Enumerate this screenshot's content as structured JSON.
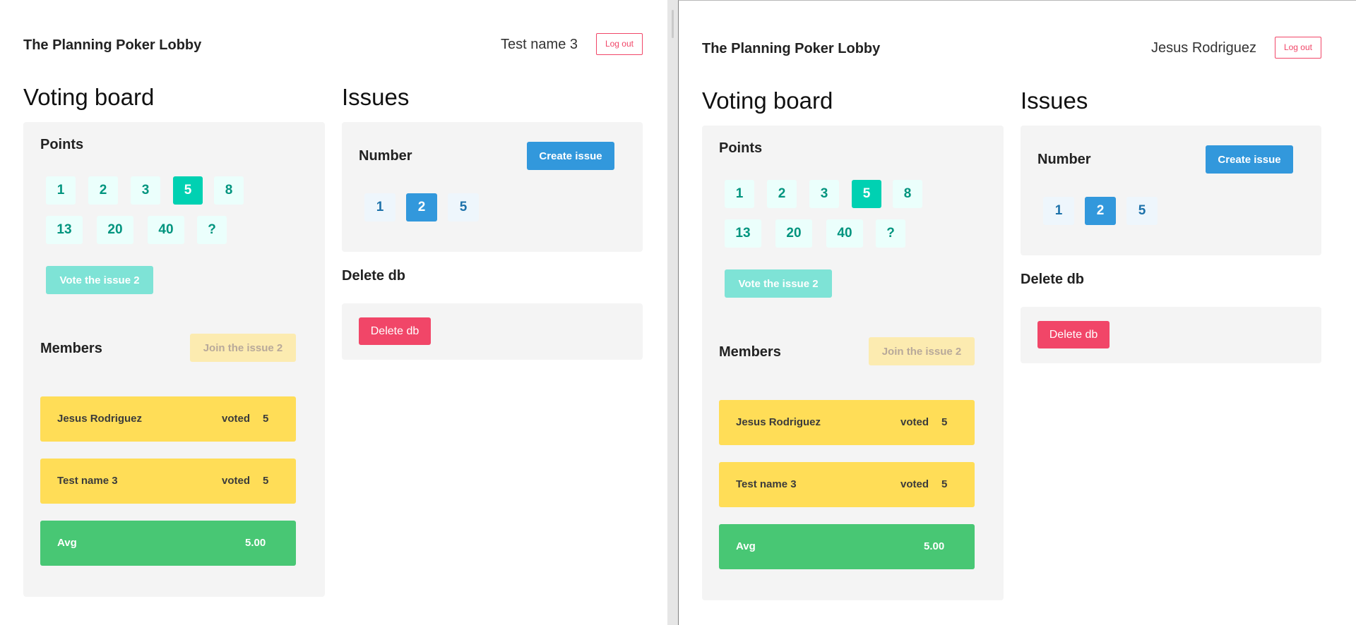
{
  "windows": [
    {
      "brand": "The Planning Poker Lobby",
      "username": "Test name 3",
      "logout_label": "Log out",
      "voting_title": "Voting board",
      "points_title": "Points",
      "points": [
        "1",
        "2",
        "3",
        "5",
        "8",
        "13",
        "20",
        "40",
        "?"
      ],
      "selected_point": "5",
      "vote_button": "Vote the issue 2",
      "members_title": "Members",
      "join_button": "Join the issue 2",
      "members": [
        {
          "name": "Jesus Rodriguez",
          "status": "voted",
          "value": "5"
        },
        {
          "name": "Test name 3",
          "status": "voted",
          "value": "5"
        }
      ],
      "avg_label": "Avg",
      "avg_value": "5.00",
      "issues_title": "Issues",
      "number_title": "Number",
      "create_button": "Create issue",
      "issues": [
        "1",
        "2",
        "5"
      ],
      "selected_issue": "2",
      "delete_title": "Delete db",
      "delete_button": "Delete db"
    },
    {
      "brand": "The Planning Poker Lobby",
      "username": "Jesus Rodriguez",
      "logout_label": "Log out",
      "voting_title": "Voting board",
      "points_title": "Points",
      "points": [
        "1",
        "2",
        "3",
        "5",
        "8",
        "13",
        "20",
        "40",
        "?"
      ],
      "selected_point": "5",
      "vote_button": "Vote the issue 2",
      "members_title": "Members",
      "join_button": "Join the issue 2",
      "members": [
        {
          "name": "Jesus Rodriguez",
          "status": "voted",
          "value": "5"
        },
        {
          "name": "Test name 3",
          "status": "voted",
          "value": "5"
        }
      ],
      "avg_label": "Avg",
      "avg_value": "5.00",
      "issues_title": "Issues",
      "number_title": "Number",
      "create_button": "Create issue",
      "issues": [
        "1",
        "2",
        "5"
      ],
      "selected_issue": "2",
      "delete_title": "Delete db",
      "delete_button": "Delete db"
    }
  ],
  "colors": {
    "primary": "#00d1b2",
    "info": "#3298dc",
    "warning": "#ffdd57",
    "success": "#48c774",
    "danger": "#f14668",
    "panel": "#f4f4f4"
  }
}
